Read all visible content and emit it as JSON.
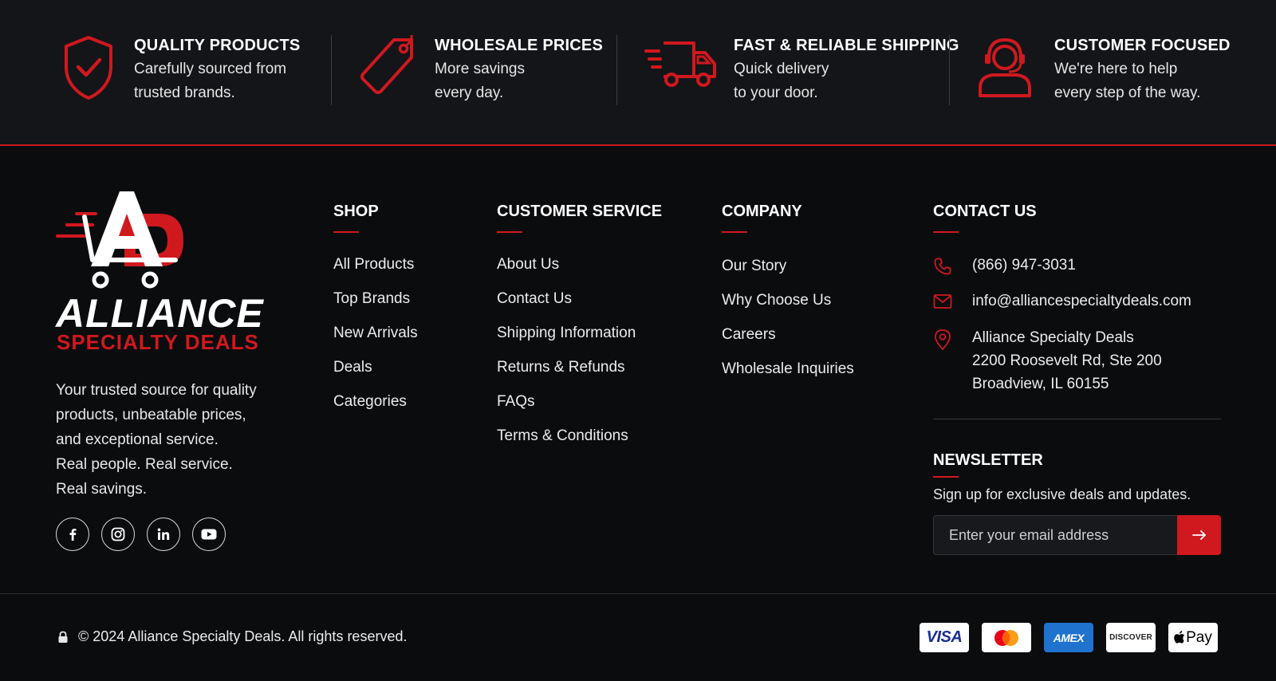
{
  "features": [
    {
      "icon": "shield-check-icon",
      "title": "QUALITY PRODUCTS",
      "line1": "Carefully sourced from",
      "line2": "trusted brands."
    },
    {
      "icon": "price-tag-icon",
      "title": "WHOLESALE PRICES",
      "line1": "More savings",
      "line2": "every day."
    },
    {
      "icon": "delivery-truck-icon",
      "title": "FAST & RELIABLE SHIPPING",
      "line1": "Quick delivery",
      "line2": "to your door."
    },
    {
      "icon": "headset-support-icon",
      "title": "CUSTOMER FOCUSED",
      "line1": "We're here to help",
      "line2": "every step of the way."
    }
  ],
  "brand": {
    "logo_letters": "AD",
    "name_line1": "ALLIANCE",
    "name_line2": "SPECIALTY DEALS",
    "tagline": [
      "Your trusted source for quality",
      "products, unbeatable prices,",
      "and exceptional service.",
      "Real people. Real service.",
      "Real savings."
    ],
    "socials": [
      "facebook-icon",
      "instagram-icon",
      "linkedin-icon",
      "youtube-icon"
    ]
  },
  "columns": {
    "shop": {
      "title": "SHOP",
      "links": [
        "All Products",
        "Top Brands",
        "New Arrivals",
        "Deals",
        "Categories"
      ]
    },
    "service": {
      "title": "CUSTOMER SERVICE",
      "links": [
        "About Us",
        "Contact Us",
        "Shipping Information",
        "Returns & Refunds",
        "FAQs",
        "Terms & Conditions"
      ]
    },
    "company": {
      "title": "COMPANY",
      "links": [
        "Our Story",
        "Why Choose Us",
        "Careers",
        "Wholesale Inquiries"
      ]
    }
  },
  "contact": {
    "title": "CONTACT US",
    "phone": "(866) 947-3031",
    "email": "info@alliancespecialtydeals.com",
    "address_line1": "Alliance Specialty Deals",
    "address_line2": "2200 Roosevelt Rd, Ste 200",
    "address_line3": "Broadview, IL 60155"
  },
  "newsletter": {
    "title": "NEWSLETTER",
    "text": "Sign up for exclusive deals and updates.",
    "placeholder": "Enter your email address",
    "submit_icon": "arrow-right-icon"
  },
  "footer_bottom": {
    "copyright": "© 2024 Alliance Specialty Deals. All rights reserved.",
    "payments": {
      "visa": "VISA",
      "mastercard": "mastercard-icon",
      "amex": "AMEX",
      "discover": "DISCOVER",
      "applepay": "Pay"
    }
  },
  "colors": {
    "accent": "#d0181f",
    "background": "#0b0c0e",
    "strip": "#131518"
  }
}
